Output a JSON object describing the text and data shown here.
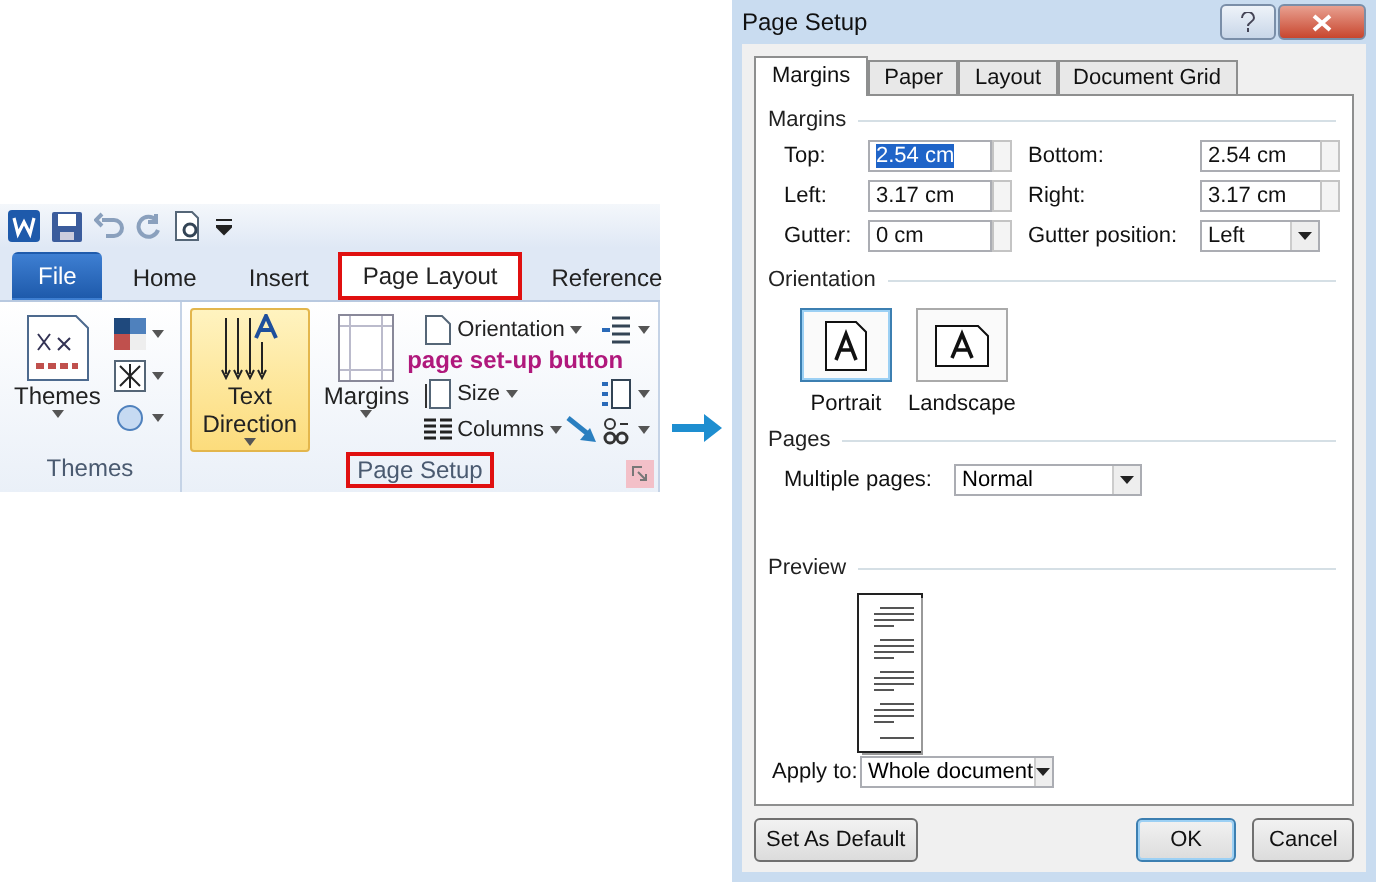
{
  "ribbon": {
    "tabs": [
      {
        "label": "File",
        "kind": "file",
        "selected": false,
        "highlighted": false
      },
      {
        "label": "Home",
        "kind": "tab",
        "selected": false,
        "highlighted": false
      },
      {
        "label": "Insert",
        "kind": "tab",
        "selected": false,
        "highlighted": false
      },
      {
        "label": "Page Layout",
        "kind": "tab",
        "selected": true,
        "highlighted": true
      },
      {
        "label": "Reference",
        "kind": "tab",
        "selected": false,
        "highlighted": false
      }
    ],
    "themes_group": {
      "label": "Themes",
      "button": "Themes"
    },
    "page_setup_group": {
      "label": "Page Setup",
      "highlighted": true,
      "launcher_highlighted": true,
      "text_direction": {
        "label": "Text Direction",
        "active": true
      },
      "margins": "Margins",
      "commands": [
        "Orientation",
        "Size",
        "Columns"
      ]
    },
    "annotation": "page set-up button"
  },
  "dialog": {
    "title": "Page Setup",
    "tabs": [
      {
        "label": "Margins",
        "selected": true
      },
      {
        "label": "Paper",
        "selected": false
      },
      {
        "label": "Layout",
        "selected": false
      },
      {
        "label": "Document Grid",
        "selected": false
      }
    ],
    "margins_section": "Margins",
    "fields": [
      {
        "label": "Top:",
        "value": "2.54 cm",
        "kind": "spin",
        "text_selected": true
      },
      {
        "label": "Bottom:",
        "value": "2.54 cm",
        "kind": "spin",
        "text_selected": false
      },
      {
        "label": "Left:",
        "value": "3.17 cm",
        "kind": "spin",
        "text_selected": false
      },
      {
        "label": "Right:",
        "value": "3.17 cm",
        "kind": "spin",
        "text_selected": false
      },
      {
        "label": "Gutter:",
        "value": "0 cm",
        "kind": "spin",
        "text_selected": false
      },
      {
        "label": "Gutter position:",
        "value": "Left",
        "kind": "select",
        "text_selected": false
      }
    ],
    "orientation_section": "Orientation",
    "orientations": [
      {
        "label": "Portrait",
        "selected": true
      },
      {
        "label": "Landscape",
        "selected": false
      }
    ],
    "pages_section": "Pages",
    "multiple_pages": {
      "label": "Multiple pages:",
      "value": "Normal"
    },
    "preview_section": "Preview",
    "apply_to": {
      "label": "Apply to:",
      "value": "Whole document"
    },
    "buttons": [
      {
        "label": "Set As Default",
        "default": false
      },
      {
        "label": "OK",
        "default": true
      },
      {
        "label": "Cancel",
        "default": false
      }
    ]
  }
}
